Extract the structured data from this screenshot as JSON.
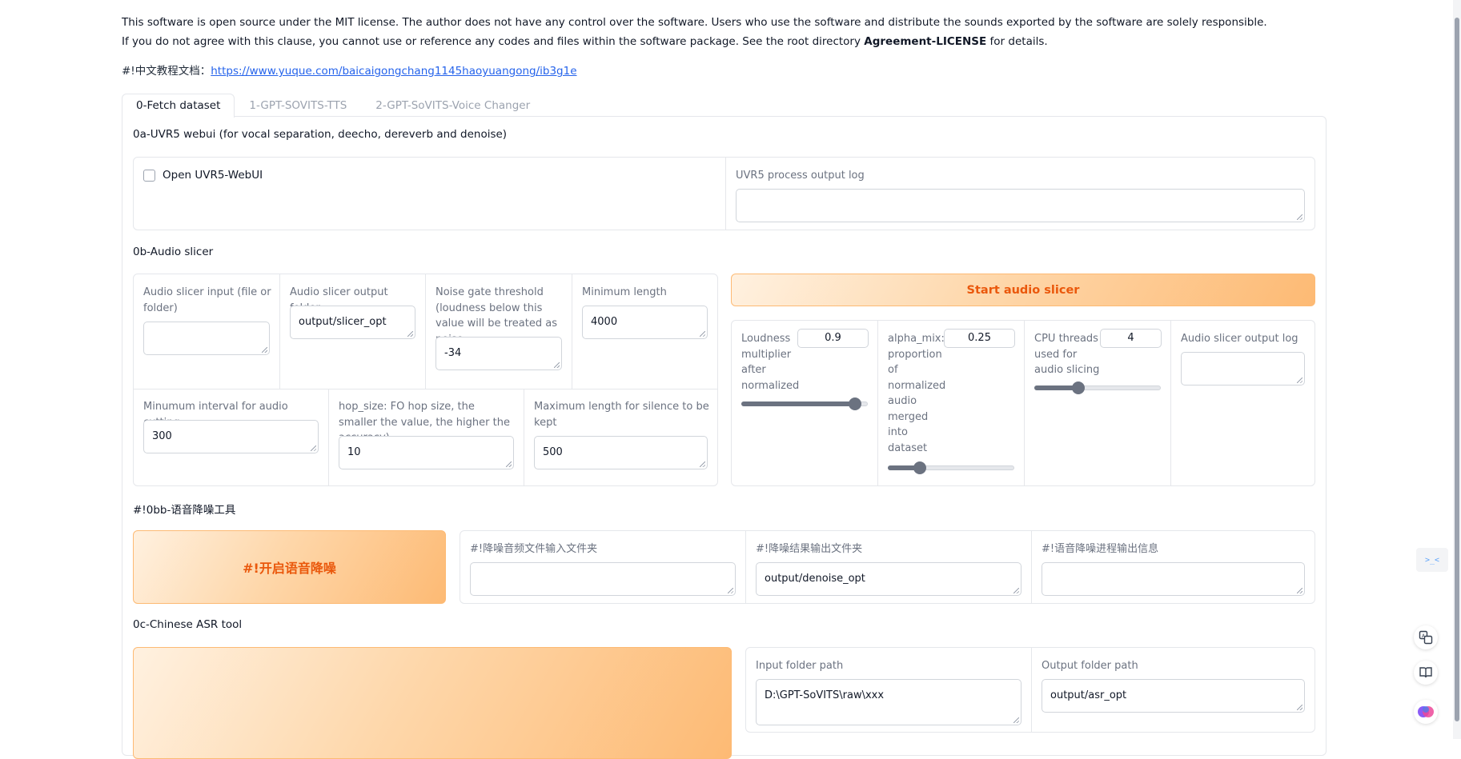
{
  "license": {
    "line1": "This software is open source under the MIT license. The author does not have any control over the software. Users who use the software and distribute the sounds exported by the software are solely responsible.",
    "line2_prefix": "If you do not agree with this clause, you cannot use or reference any codes and files within the software package. See the root directory ",
    "line2_bold": "Agreement-LICENSE",
    "line2_suffix": " for details."
  },
  "tutorial": {
    "label": "#!中文教程文档：",
    "link": "https://www.yuque.com/baicaigongchang1145haoyuangong/ib3g1e"
  },
  "tabs": [
    {
      "label": "0-Fetch dataset",
      "active": true
    },
    {
      "label": "1-GPT-SOVITS-TTS",
      "active": false
    },
    {
      "label": "2-GPT-SoVITS-Voice Changer",
      "active": false
    }
  ],
  "uvr5": {
    "section_title": "0a-UVR5 webui (for vocal separation, deecho, dereverb and denoise)",
    "open_label": "Open UVR5-WebUI",
    "log_label": "UVR5 process output log",
    "log_value": ""
  },
  "slicer": {
    "section_title": "0b-Audio slicer",
    "input_label": "Audio slicer input (file or folder)",
    "input_value": "",
    "output_label": "Audio slicer output folder",
    "output_value": "output/slicer_opt",
    "threshold_label": "Noise gate threshold (loudness below this value will be treated as noise",
    "threshold_value": "-34",
    "min_length_label": "Minimum length",
    "min_length_value": "4000",
    "min_interval_label": "Minumum interval for audio cutting",
    "min_interval_value": "300",
    "hop_size_label": "hop_size: FO hop size, the smaller the value, the higher the accuracy)",
    "hop_size_value": "10",
    "max_silence_label": "Maximum length for silence to be kept",
    "max_silence_value": "500",
    "start_button": "Start audio slicer",
    "loudness_label": "Loudness multiplier after normalized",
    "loudness_value": "0.9",
    "loudness_fraction": 0.9,
    "alpha_label": "alpha_mix: proportion of normalized audio merged into dataset",
    "alpha_value": "0.25",
    "alpha_fraction": 0.25,
    "threads_label": "CPU threads used for audio slicing",
    "threads_value": "4",
    "threads_fraction": 0.35,
    "log_label": "Audio slicer output log",
    "log_value": ""
  },
  "denoise": {
    "section_title": "#!0bb-语音降噪工具",
    "start_button": "#!开启语音降噪",
    "input_label": "#!降噪音频文件输入文件夹",
    "input_value": "",
    "output_label": "#!降噪结果输出文件夹",
    "output_value": "output/denoise_opt",
    "log_label": "#!语音降噪进程输出信息",
    "log_value": ""
  },
  "asr": {
    "section_title": "0c-Chinese ASR tool",
    "input_label": "Input folder path",
    "input_value": "D:\\GPT-SoVITS\\raw\\xxx",
    "output_label": "Output folder path",
    "output_value": "output/asr_opt"
  },
  "side": {
    "dev_icon_text": ">_<"
  },
  "colors": {
    "accent_orange": "#ea580c",
    "button_gradient_end": "#fdba74",
    "link_blue": "#2563eb"
  }
}
